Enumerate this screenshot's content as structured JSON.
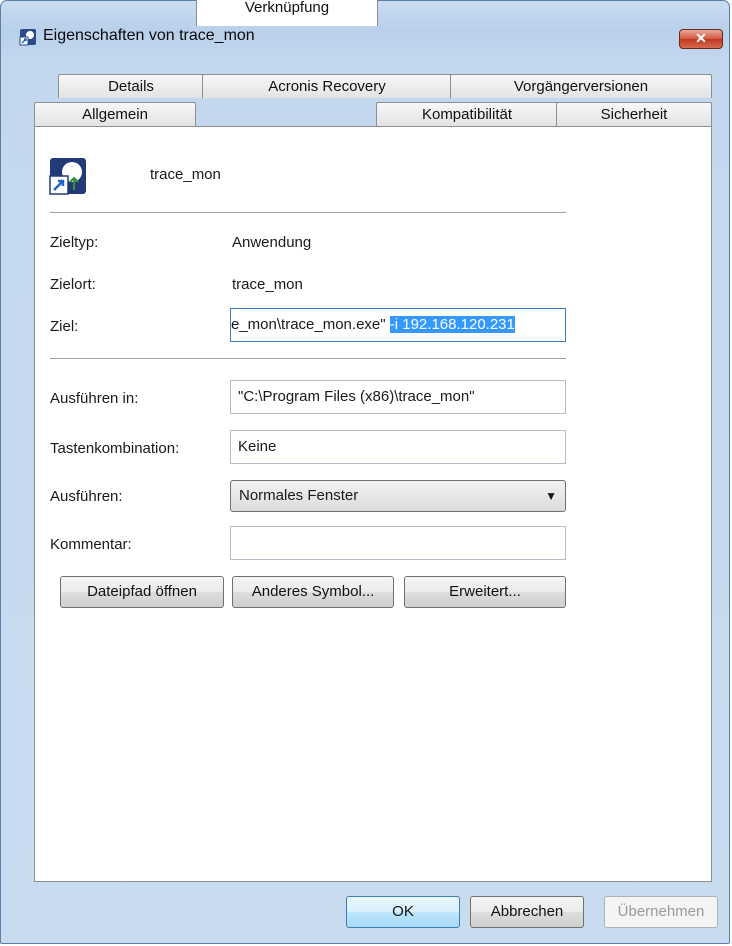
{
  "window": {
    "title": "Eigenschaften von trace_mon",
    "close_glyph": "✕"
  },
  "tabs": {
    "row1": [
      "Details",
      "Acronis Recovery",
      "Vorgängerversionen"
    ],
    "row2": [
      "Allgemein",
      "Verknüpfung",
      "Kompatibilität",
      "Sicherheit"
    ],
    "active": "Verknüpfung"
  },
  "shortcut": {
    "name": "trace_mon",
    "icon": "shortcut-app-icon"
  },
  "fields": {
    "zieltyp_label": "Zieltyp:",
    "zieltyp_value": "Anwendung",
    "zielort_label": "Zielort:",
    "zielort_value": "trace_mon",
    "ziel_label": "Ziel:",
    "ziel_value_plain": "e_mon\\trace_mon.exe\" ",
    "ziel_value_selected": "-i 192.168.120.231",
    "ausfuehren_in_label": "Ausführen in:",
    "ausfuehren_in_value": "\"C:\\Program Files (x86)\\trace_mon\"",
    "tastenkombination_label": "Tastenkombination:",
    "tastenkombination_value": "Keine",
    "ausfuehren_label": "Ausführen:",
    "ausfuehren_value": "Normales Fenster",
    "kommentar_label": "Kommentar:",
    "kommentar_value": ""
  },
  "buttons": {
    "dateipfad": "Dateipfad öffnen",
    "symbol": "Anderes Symbol...",
    "erweitert": "Erweitert...",
    "ok": "OK",
    "abbrechen": "Abbrechen",
    "uebernehmen": "Übernehmen"
  },
  "colors": {
    "selection": "#3399ff",
    "titlebar": "#c9dcf1",
    "close": "#c2361f"
  }
}
